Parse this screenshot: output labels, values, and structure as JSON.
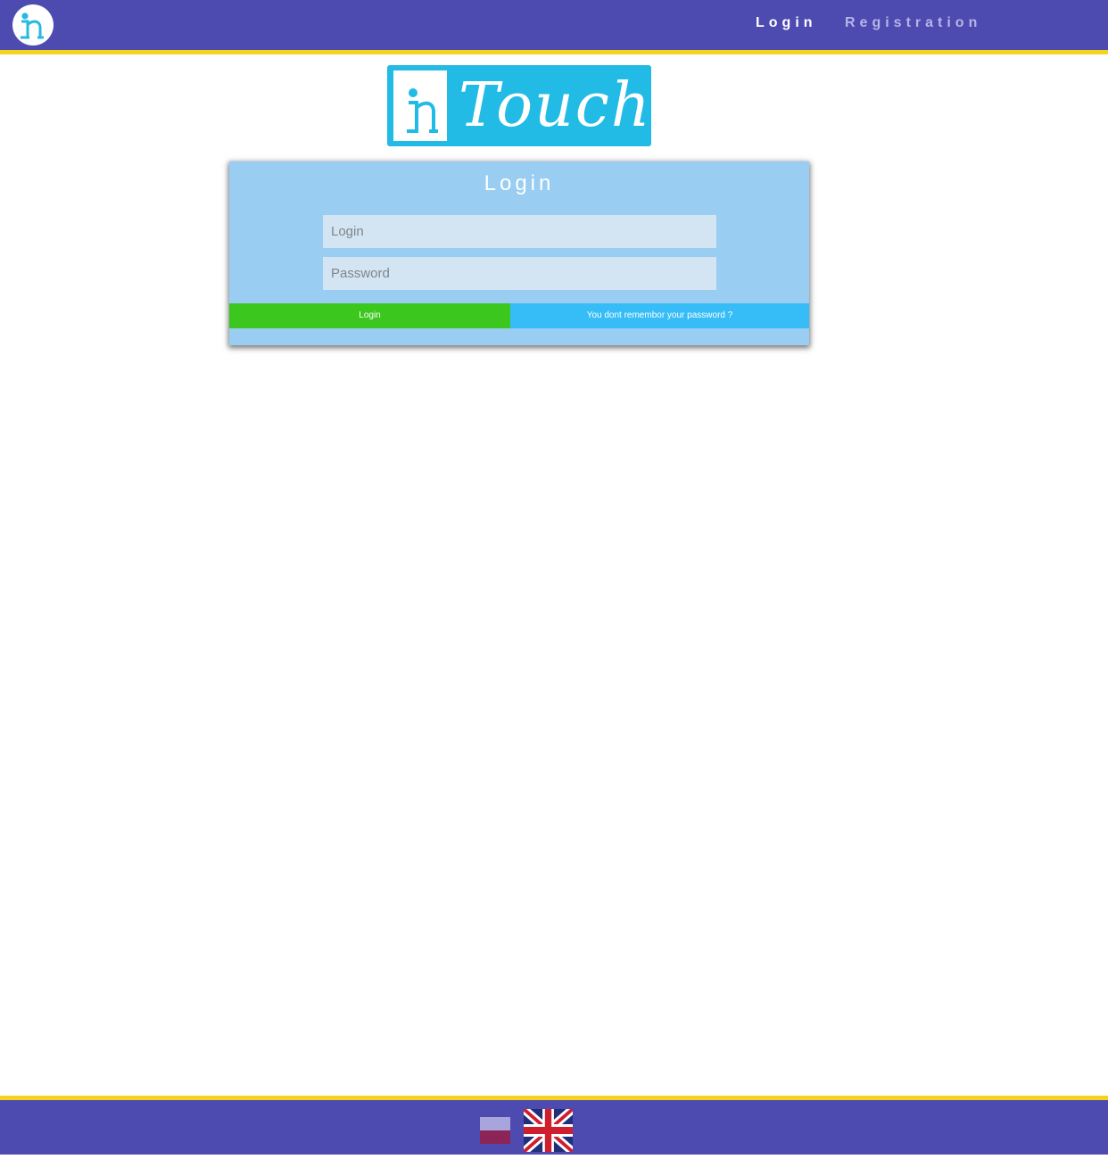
{
  "header": {
    "logo_icon": "in-logo-icon",
    "nav": {
      "login_label": "Login",
      "registration_label": "Registration"
    }
  },
  "brand": {
    "wordmark": "Touch",
    "icon": "in-logo-icon"
  },
  "login_form": {
    "title": "Login",
    "login_placeholder": "Login",
    "login_value": "",
    "password_placeholder": "Password",
    "password_value": "",
    "submit_label": "Login",
    "forgot_label": "You dont remembor your password ?"
  },
  "footer": {
    "languages": [
      {
        "icon": "polish-flag-icon"
      },
      {
        "icon": "uk-flag-icon"
      }
    ]
  },
  "colors": {
    "header_bg": "#4e4bb0",
    "accent_stripe": "#f5d41f",
    "brand_blue": "#22bbe5",
    "card_bg": "#99cdf1",
    "submit_green": "#3cc71f",
    "forgot_blue": "#36bdf7"
  }
}
